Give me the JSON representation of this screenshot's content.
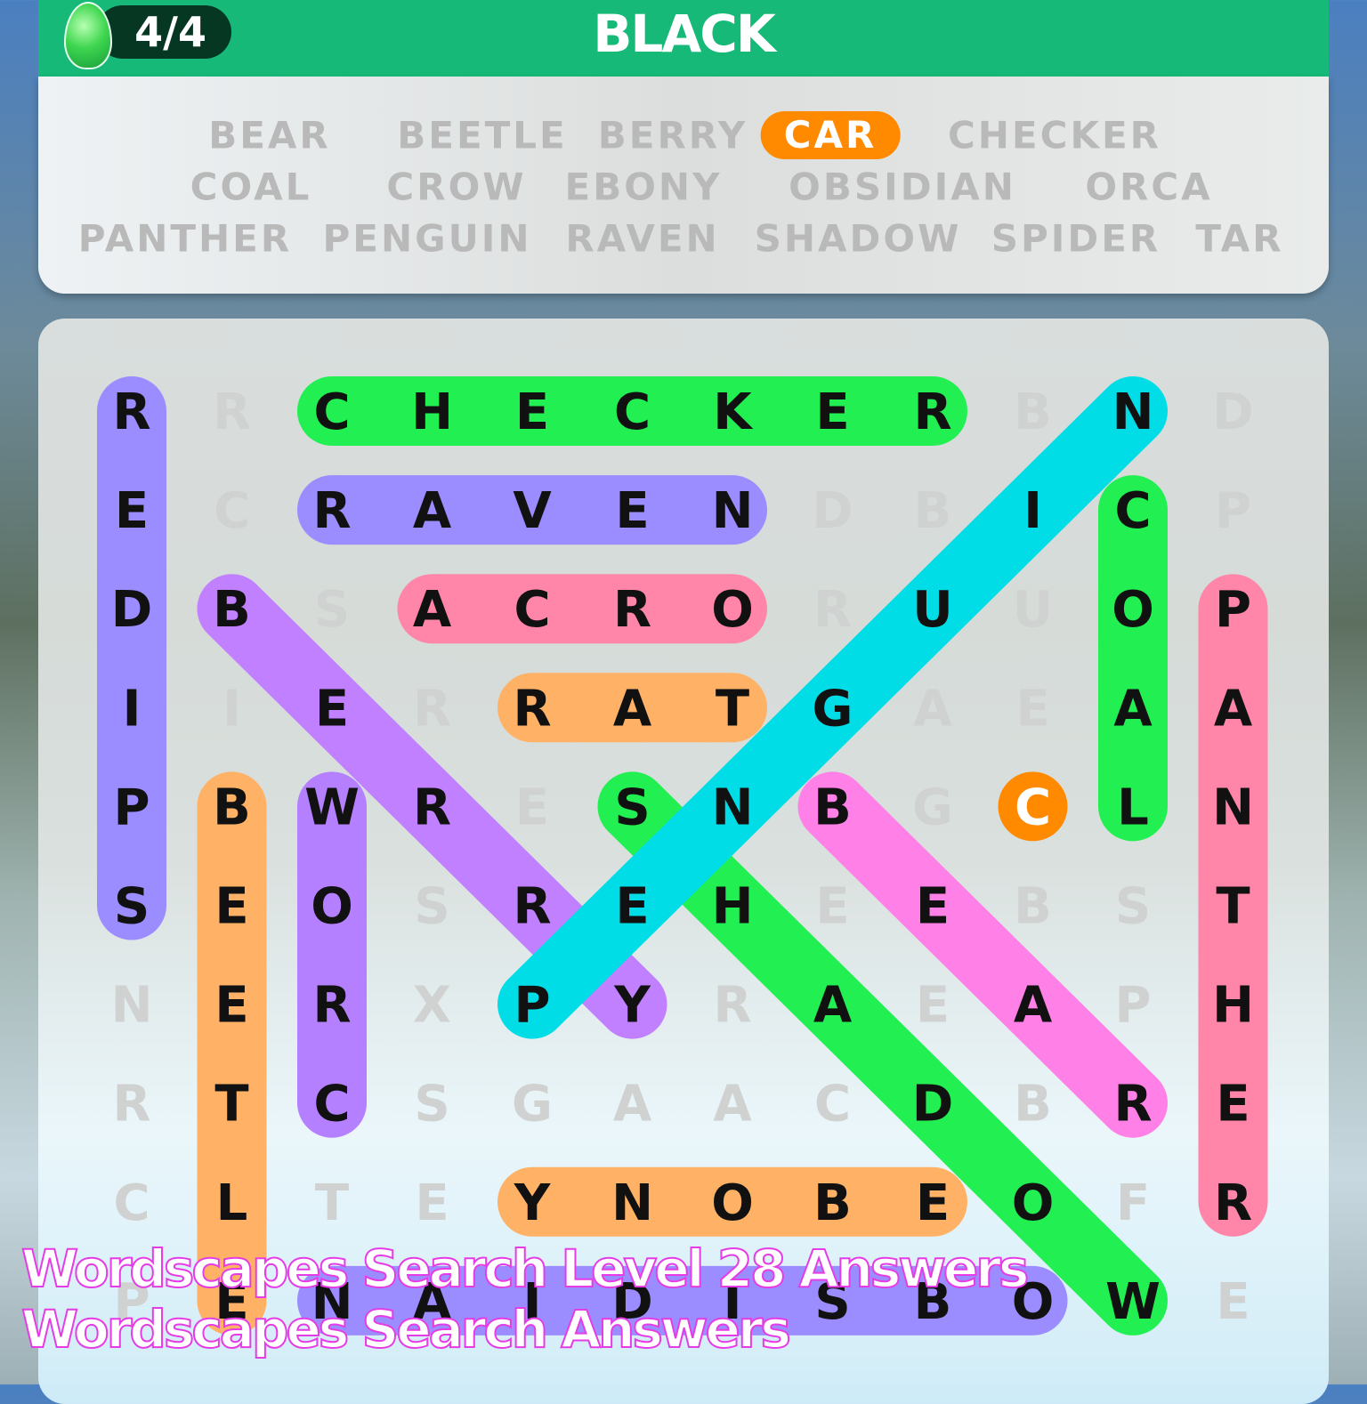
{
  "header": {
    "progress": "4/4",
    "title": "BLACK",
    "gem_icon": "green-gem-icon",
    "color": "#17b978"
  },
  "word_list": [
    {
      "word": "BEAR",
      "found": false
    },
    {
      "word": "BEETLE",
      "found": false
    },
    {
      "word": "BERRY",
      "found": false
    },
    {
      "word": "CAR",
      "found": true
    },
    {
      "word": "CHECKER",
      "found": false
    },
    {
      "word": "COAL",
      "found": false
    },
    {
      "word": "CROW",
      "found": false
    },
    {
      "word": "EBONY",
      "found": false
    },
    {
      "word": "OBSIDIAN",
      "found": false
    },
    {
      "word": "ORCA",
      "found": false
    },
    {
      "word": "PANTHER",
      "found": false
    },
    {
      "word": "PENGUIN",
      "found": false
    },
    {
      "word": "RAVEN",
      "found": false
    },
    {
      "word": "SHADOW",
      "found": false
    },
    {
      "word": "SPIDER",
      "found": false
    },
    {
      "word": "TAR",
      "found": false
    }
  ],
  "grid": [
    "RRCHECKERBND",
    "ECRAVENDBICP",
    "DBSACRORUUOP",
    "IIERRATGAEAA",
    "PBWRESNBGCLN",
    "SEOSREHEEBST",
    "NERXPYRAEAPH",
    "RTCSGAACDBRE",
    "CLTEYNOBEOFR",
    "PENAIDISBOWE"
  ],
  "highlights": [
    {
      "word": "SPIDER",
      "color": "#9b8cff",
      "start": [
        0,
        0
      ],
      "end": [
        5,
        0
      ]
    },
    {
      "word": "CHECKER",
      "color": "#22f052",
      "start": [
        0,
        2
      ],
      "end": [
        0,
        8
      ]
    },
    {
      "word": "RAVEN",
      "color": "#9b8cff",
      "start": [
        1,
        2
      ],
      "end": [
        1,
        6
      ]
    },
    {
      "word": "ORCA",
      "color": "#ff86a8",
      "start": [
        2,
        3
      ],
      "end": [
        2,
        6
      ]
    },
    {
      "word": "TAR",
      "color": "#ffb266",
      "start": [
        3,
        4
      ],
      "end": [
        3,
        6
      ]
    },
    {
      "word": "BEETLE",
      "color": "#ffb266",
      "start": [
        4,
        1
      ],
      "end": [
        9,
        1
      ]
    },
    {
      "word": "CROW",
      "color": "#b580ff",
      "start": [
        4,
        2
      ],
      "end": [
        7,
        2
      ]
    },
    {
      "word": "BERRY",
      "color": "#c080ff",
      "start": [
        2,
        1
      ],
      "end": [
        6,
        5
      ]
    },
    {
      "word": "SHADOW",
      "color": "#22f052",
      "start": [
        4,
        5
      ],
      "end": [
        9,
        10
      ]
    },
    {
      "word": "BEAR",
      "color": "#ff80e6",
      "start": [
        4,
        7
      ],
      "end": [
        7,
        10
      ]
    },
    {
      "word": "PENGUIN",
      "color": "#00dde6",
      "start": [
        6,
        4
      ],
      "end": [
        0,
        10
      ]
    },
    {
      "word": "COAL",
      "color": "#22f052",
      "start": [
        1,
        10
      ],
      "end": [
        4,
        10
      ]
    },
    {
      "word": "PANTHER",
      "color": "#ff86a8",
      "start": [
        2,
        11
      ],
      "end": [
        8,
        11
      ]
    },
    {
      "word": "CAR",
      "color": "#ff8a00",
      "start": [
        4,
        9
      ],
      "end": [
        4,
        9
      ]
    },
    {
      "word": "EBONY",
      "color": "#ffb266",
      "start": [
        8,
        4
      ],
      "end": [
        8,
        8
      ]
    },
    {
      "word": "OBSIDIAN",
      "color": "#9b8cff",
      "start": [
        9,
        2
      ],
      "end": [
        9,
        9
      ]
    }
  ],
  "watermark": {
    "line1": "Wordscapes Search Level 28 Answers",
    "line2": "Wordscapes Search Answers"
  }
}
